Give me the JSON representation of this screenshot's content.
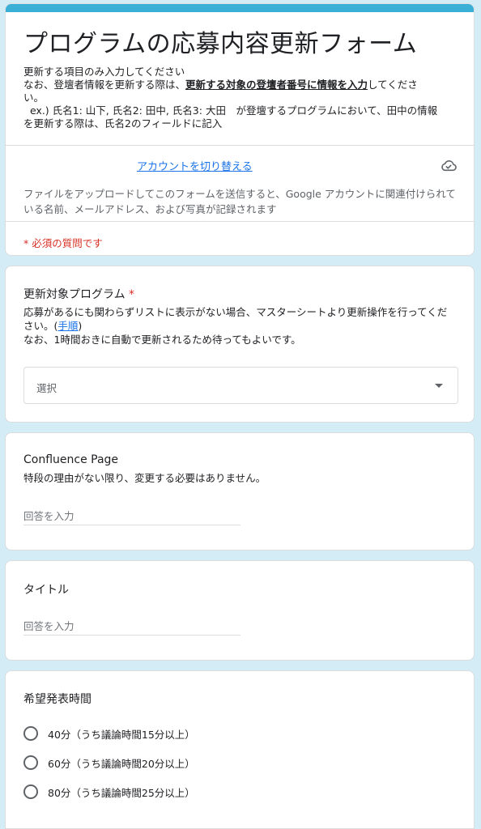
{
  "form": {
    "title": "プログラムの応募内容更新フォーム",
    "description": {
      "line1": "更新する項目のみ入力してください",
      "line2_pre": "なお、登壇者情報を更新する際は、",
      "line2_bold": "更新する対象の登壇者番号に情報を入力",
      "line2_post": "してくださ",
      "line3": "い。",
      "line4": "  ex.) 氏名1: 山下, 氏名2: 田中, 氏名3: 大田　が登壇するプログラムにおいて、田中の情報",
      "line5": "を更新する際は、氏名2のフィールドに記入"
    },
    "switch_account": "アカウントを切り替える",
    "upload_notice": "ファイルをアップロードしてこのフォームを送信すると、Google アカウントに関連付けられている名前、メールアドレス、および写真が記録されます",
    "required_note": "* 必須の質問です"
  },
  "q_program": {
    "title": "更新対象プログラム",
    "required_mark": "*",
    "desc_line1_pre": "応募があるにも関わらずリストに表示がない場合、マスターシートより更新操作を行ってください。(",
    "desc_link": "手順",
    "desc_line1_post": ")",
    "desc_line2": "なお、1時間おきに自動で更新されるため待ってもよいです。",
    "select_placeholder": "選択"
  },
  "q_confluence": {
    "title": "Confluence Page",
    "desc": "特段の理由がない限り、変更する必要はありません。",
    "placeholder": "回答を入力"
  },
  "q_title": {
    "title": "タイトル",
    "placeholder": "回答を入力"
  },
  "q_time": {
    "title": "希望発表時間",
    "options": [
      {
        "label": "40分（うち議論時間15分以上）"
      },
      {
        "label": "60分（うち議論時間20分以上）"
      },
      {
        "label": "80分（うち議論時間25分以上）"
      }
    ]
  },
  "colors": {
    "accent": "#3bb0d6",
    "background": "#d3ecf5",
    "required": "#d93025",
    "link": "#1a73e8"
  },
  "icons": {
    "account": "cloud-check-icon"
  }
}
